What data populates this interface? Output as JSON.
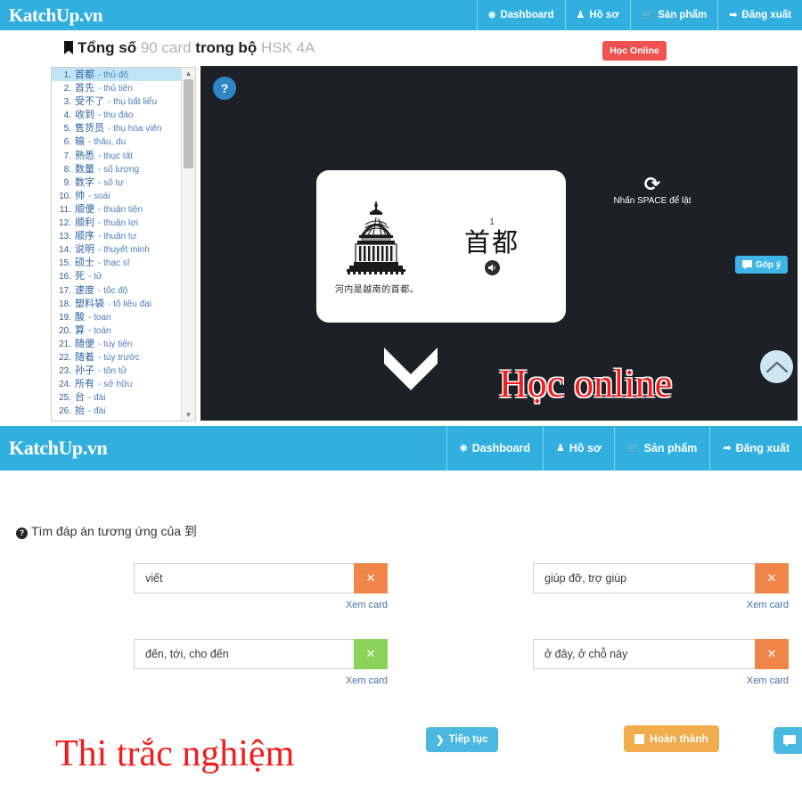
{
  "brand": "KatchUp.vn",
  "nav": {
    "items": [
      {
        "label": "Dashboard",
        "icon": "dashboard-icon",
        "glyph": "⎈"
      },
      {
        "label": "Hồ sơ",
        "icon": "user-icon",
        "glyph": "♟"
      },
      {
        "label": "Sản phẩm",
        "icon": "cart-icon",
        "glyph": "🛒"
      },
      {
        "label": "Đăng xuất",
        "icon": "logout-icon",
        "glyph": "⮕"
      }
    ]
  },
  "flashcard_page": {
    "title_prefix": "Tổng số",
    "count": "90 card",
    "title_mid": "trong bộ",
    "deck": "HSK 4A",
    "hoc_online_button": "Học Online",
    "help_button": "?",
    "gop_y_button": "Góp ý",
    "flip_hint": "Nhấn SPACE để lật",
    "card": {
      "index": "1",
      "word": "首都",
      "sentence": "河内是越南的首都。"
    },
    "wordlist": [
      {
        "n": "1.",
        "hz": "首都",
        "vn": "- thủ đô",
        "selected": true
      },
      {
        "n": "2.",
        "hz": "首先",
        "vn": "- thủ tiên",
        "selected": false
      },
      {
        "n": "3.",
        "hz": "受不了",
        "vn": "- thụ bất liểu",
        "selected": false
      },
      {
        "n": "4.",
        "hz": "收到",
        "vn": "- thu đáo",
        "selected": false
      },
      {
        "n": "5.",
        "hz": "售货员",
        "vn": "- thụ hóa viên",
        "selected": false
      },
      {
        "n": "6.",
        "hz": "输",
        "vn": "- thâu, du",
        "selected": false
      },
      {
        "n": "7.",
        "hz": "熟悉",
        "vn": "- thục tất",
        "selected": false
      },
      {
        "n": "8.",
        "hz": "数量",
        "vn": "- số lượng",
        "selected": false
      },
      {
        "n": "9.",
        "hz": "数字",
        "vn": "- số tự",
        "selected": false
      },
      {
        "n": "10.",
        "hz": "帅",
        "vn": "- soái",
        "selected": false
      },
      {
        "n": "11.",
        "hz": "顺便",
        "vn": "- thuận tiện",
        "selected": false
      },
      {
        "n": "12.",
        "hz": "顺利",
        "vn": "- thuận lợi",
        "selected": false
      },
      {
        "n": "13.",
        "hz": "顺序",
        "vn": "- thuận tự",
        "selected": false
      },
      {
        "n": "14.",
        "hz": "说明",
        "vn": "- thuyết minh",
        "selected": false
      },
      {
        "n": "15.",
        "hz": "硕士",
        "vn": "- thạc sĩ",
        "selected": false
      },
      {
        "n": "16.",
        "hz": "死",
        "vn": "- tử",
        "selected": false
      },
      {
        "n": "17.",
        "hz": "速度",
        "vn": "- tốc độ",
        "selected": false
      },
      {
        "n": "18.",
        "hz": "塑料袋",
        "vn": "- tố liệu đại",
        "selected": false
      },
      {
        "n": "19.",
        "hz": "酸",
        "vn": "- toan",
        "selected": false
      },
      {
        "n": "20.",
        "hz": "算",
        "vn": "- toán",
        "selected": false
      },
      {
        "n": "21.",
        "hz": "随便",
        "vn": "- túy tiện",
        "selected": false
      },
      {
        "n": "22.",
        "hz": "随着",
        "vn": "- túy trước",
        "selected": false
      },
      {
        "n": "23.",
        "hz": "孙子",
        "vn": "- tôn tử",
        "selected": false
      },
      {
        "n": "24.",
        "hz": "所有",
        "vn": "- sở hữu",
        "selected": false
      },
      {
        "n": "25.",
        "hz": "台",
        "vn": "- đài",
        "selected": false
      },
      {
        "n": "26.",
        "hz": "抬",
        "vn": "- đài",
        "selected": false
      }
    ]
  },
  "quiz_page": {
    "question_prefix": "Tìm đáp án tương ứng của",
    "question_word": "到",
    "xem_card": "Xem card",
    "answers": [
      {
        "value": "viết",
        "state": "orange",
        "mark": "✕"
      },
      {
        "value": "giúp đỡ, trợ giúp",
        "state": "orange",
        "mark": "✕"
      },
      {
        "value": "đến, tới, cho đến",
        "state": "green",
        "mark": "✕"
      },
      {
        "value": "ở đây, ở chỗ này",
        "state": "orange",
        "mark": "✕"
      }
    ],
    "tiep_tuc_button": "Tiếp tục",
    "hoan_thanh_button": "Hoàn thành"
  },
  "overlays": {
    "hoc_online": "Học online",
    "thi_trac_nghiem": "Thi trắc nghiệm"
  },
  "colors": {
    "brand_blue": "#31b0e0",
    "red_button": "#ef5350",
    "orange": "#f0854a",
    "green": "#8bd45a",
    "amber": "#f0ac4d",
    "overlay_red": "#f41b1b",
    "stage_dark": "#1d2026"
  }
}
